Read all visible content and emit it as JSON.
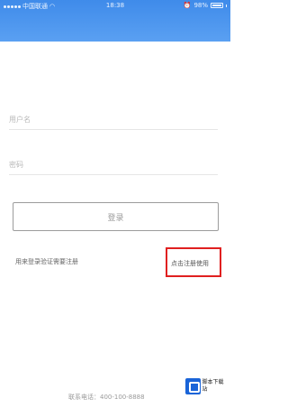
{
  "status_bar": {
    "carrier": "中国联通",
    "time": "18:38",
    "battery": "98%"
  },
  "form": {
    "username_placeholder": "用户名",
    "password_placeholder": "密码",
    "login_label": "登录"
  },
  "register": {
    "prompt": "用来登录验证需要注册",
    "link_label": "点击注册使用"
  },
  "footer": {
    "phone": "联系电话：400-100-8888"
  },
  "watermark": {
    "text": "脚本下载站"
  },
  "colors": {
    "header": "#4a95ef",
    "highlight_box": "#e02020"
  }
}
